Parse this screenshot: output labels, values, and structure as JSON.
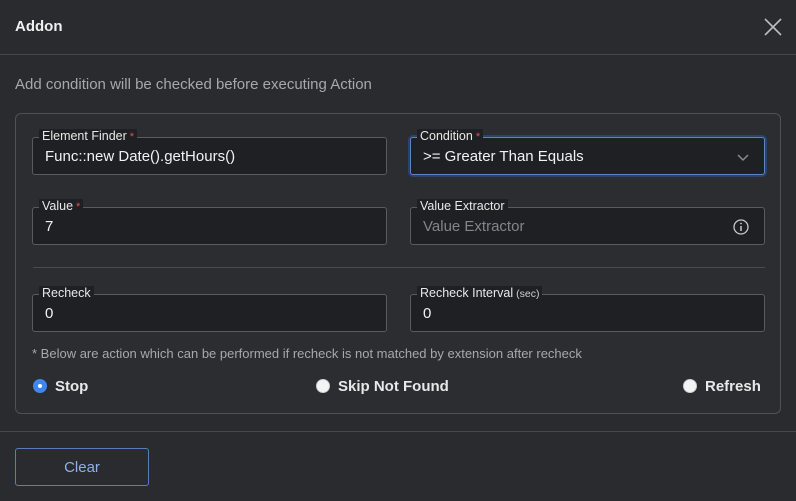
{
  "dialog": {
    "title": "Addon",
    "subtitle": "Add condition will be checked before executing Action",
    "close_icon": "close-icon"
  },
  "fields": {
    "element_finder": {
      "label": "Element Finder",
      "required": "*",
      "value": "Func::new Date().getHours()"
    },
    "condition": {
      "label": "Condition",
      "required": "*",
      "value": ">= Greater Than Equals",
      "icon": "chevron-down-icon"
    },
    "value": {
      "label": "Value",
      "required": "*",
      "value": "7"
    },
    "value_extractor": {
      "label": "Value Extractor",
      "placeholder": "Value Extractor",
      "icon": "info-icon"
    },
    "recheck": {
      "label": "Recheck",
      "value": "0"
    },
    "recheck_interval": {
      "label": "Recheck Interval",
      "unit": "(sec)",
      "value": "0"
    }
  },
  "note": "* Below are action which can be performed if recheck is not matched by extension after recheck",
  "recheck_actions": {
    "selected": "Stop",
    "options": [
      "Stop",
      "Skip Not Found",
      "Refresh"
    ]
  },
  "footer": {
    "clear_label": "Clear"
  },
  "colors": {
    "accent": "#3f86f0",
    "required": "#e05050",
    "background": "#2a2b2e"
  }
}
